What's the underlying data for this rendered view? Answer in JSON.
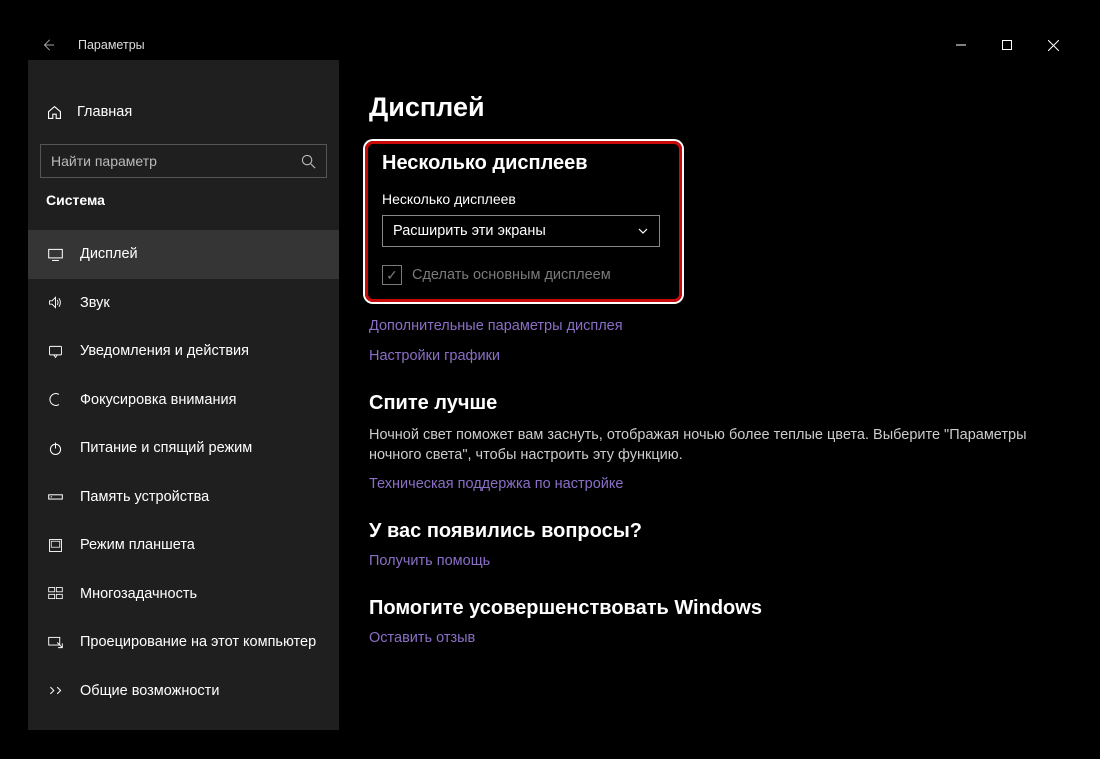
{
  "window": {
    "title": "Параметры"
  },
  "sidebar": {
    "home": "Главная",
    "search_placeholder": "Найти параметр",
    "section": "Система",
    "items": [
      {
        "label": "Дисплей"
      },
      {
        "label": "Звук"
      },
      {
        "label": "Уведомления и действия"
      },
      {
        "label": "Фокусировка внимания"
      },
      {
        "label": "Питание и спящий режим"
      },
      {
        "label": "Память устройства"
      },
      {
        "label": "Режим планшета"
      },
      {
        "label": "Многозадачность"
      },
      {
        "label": "Проецирование на этот компьютер"
      },
      {
        "label": "Общие возможности"
      }
    ]
  },
  "main": {
    "page_title": "Дисплей",
    "multi": {
      "heading": "Несколько дисплеев",
      "label": "Несколько дисплеев",
      "value": "Расширить эти экраны",
      "checkbox": "Сделать основным дисплеем"
    },
    "links": {
      "adv": "Дополнительные параметры дисплея",
      "graphics": "Настройки графики"
    },
    "sleep": {
      "heading": "Спите лучше",
      "desc": "Ночной свет поможет вам заснуть, отображая ночью более теплые цвета. Выберите \"Параметры ночного света\", чтобы настроить эту функцию.",
      "link": "Техническая поддержка по настройке"
    },
    "help": {
      "heading": "У вас появились вопросы?",
      "link": "Получить помощь"
    },
    "feedback": {
      "heading": "Помогите усовершенствовать Windows",
      "link": "Оставить отзыв"
    }
  }
}
